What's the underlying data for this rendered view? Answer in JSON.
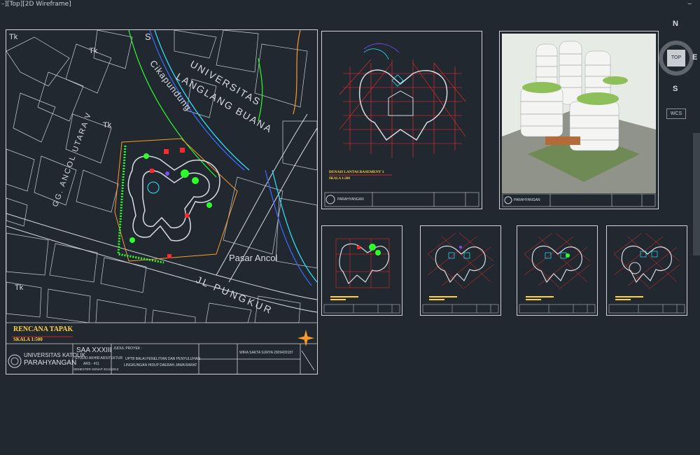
{
  "viewport": {
    "label": "–][Top][2D Wireframe]"
  },
  "window_controls": {
    "minimize": "–"
  },
  "colors": {
    "background": "#212830",
    "red": "#ff2a2a",
    "green": "#2dff2d",
    "cyan": "#2ee5ff",
    "yellow": "#ffd23a",
    "purple": "#7a4cff"
  },
  "site_plan": {
    "title": "RENCANA TAPAK",
    "scale": "SKALA 1:500",
    "labels": {
      "university": "UNIVERSITAS",
      "langlang": "LANGLANG BUANA",
      "river": "Cikapundung",
      "street_ancol": "GG. ANCOL UTARA V",
      "market": "Pasar Ancol",
      "road": "JL PUNGKUR",
      "tk": "Tk",
      "s": "S"
    },
    "titleblock": {
      "uni_line1": "UNIVERSITAS KATOLIK",
      "uni_line2": "PARAHYANGAN",
      "course": "SAA XXXIII",
      "studio": "STUDIO AKHIR ARSITEKTUR",
      "code": "ARS - 411",
      "semester": "SEMESTER GENAP 2012/2013",
      "project_label": "JUDUL PROYEK :",
      "project_line1": "UPTB BALAI PENELITIAN DAN PENYULUHAN",
      "project_line2": "LINGKUNGAN HIDUP DAERAH JAWA BARAT",
      "student": "WIRA SAKTA SURYA",
      "student_id": "2009420187"
    }
  },
  "basement_sheet": {
    "title": "DENAH LANTAI BASEMENT 1",
    "scale": "SKALA 1:200",
    "uni": "PARAHYANGAN"
  },
  "render_sheet": {
    "uni": "PARAHYANGAN"
  },
  "nav": {
    "north": "N",
    "south": "S",
    "east": "E",
    "top": "TOP",
    "wcs": "WCS"
  }
}
